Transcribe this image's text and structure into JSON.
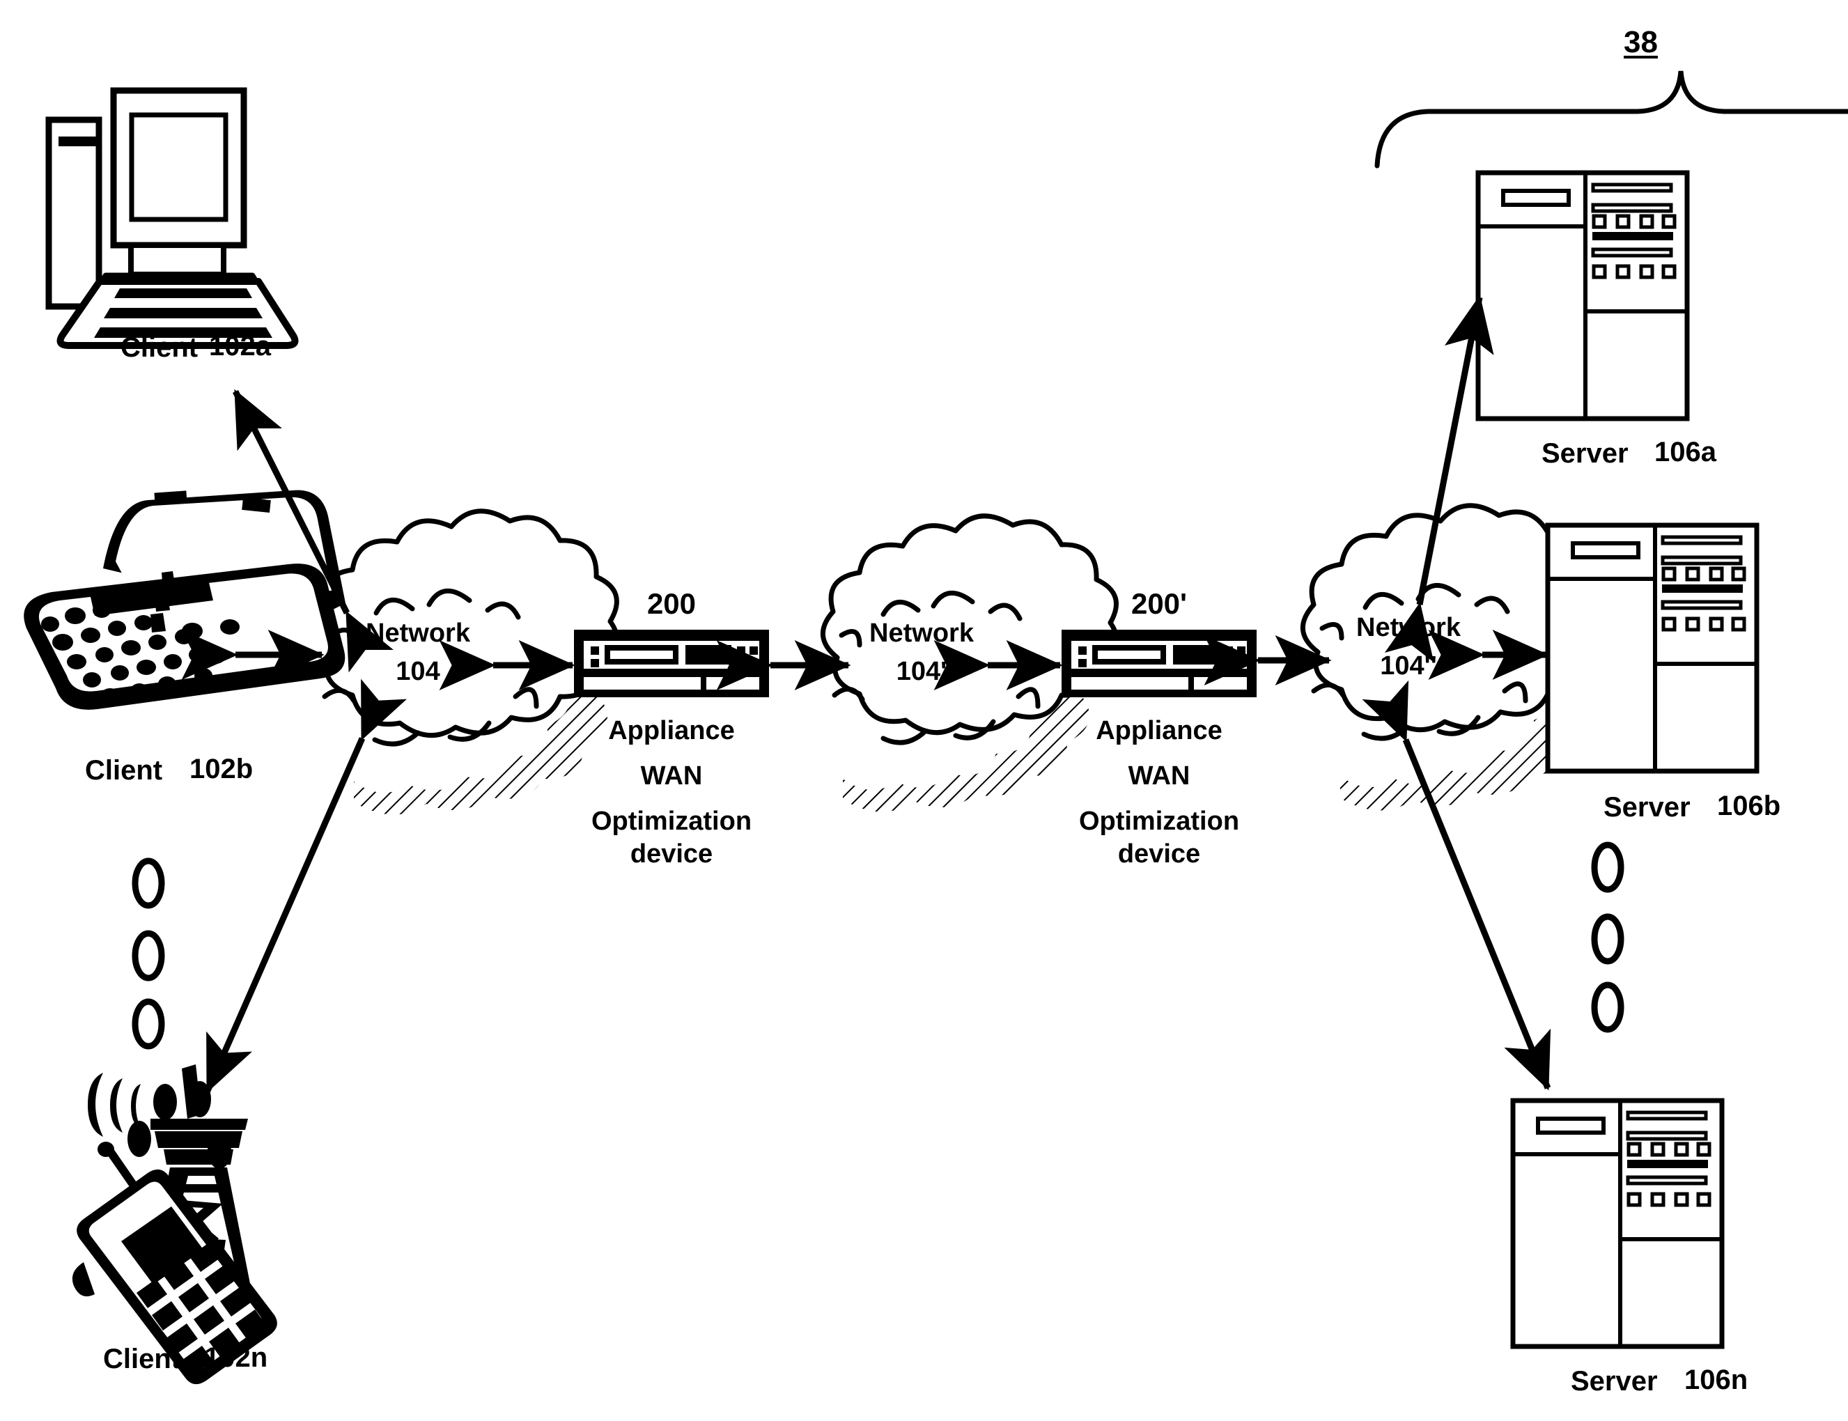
{
  "figure": {
    "reference_numeral": "38",
    "background_color": "#ffffff",
    "line_color": "#000000"
  },
  "clients": [
    {
      "id": "102a",
      "name": "Client",
      "number": "102a",
      "icon": "desktop-computer-icon"
    },
    {
      "id": "102b",
      "name": "Client",
      "number": "102b",
      "icon": "laptop-computer-icon"
    },
    {
      "id": "102n",
      "name": "Client",
      "number": "102n",
      "icon": "mobile-phone-tower-icon"
    }
  ],
  "client_ellipsis": "⚬ ⚬ ⚬",
  "networks": [
    {
      "id": "104",
      "name": "Network",
      "number": "104",
      "icon": "cloud-icon"
    },
    {
      "id": "104p",
      "name": "Network",
      "number": "104'",
      "icon": "cloud-icon"
    },
    {
      "id": "104pp",
      "name": "Network",
      "number": "104''",
      "icon": "cloud-icon"
    }
  ],
  "appliances": [
    {
      "id": "200",
      "number": "200",
      "icon": "network-appliance-icon",
      "caption_lines": [
        "Appliance",
        "WAN",
        "Optimization",
        "device"
      ]
    },
    {
      "id": "200p",
      "number": "200'",
      "icon": "network-appliance-icon",
      "caption_lines": [
        "Appliance",
        "WAN",
        "Optimization",
        "device"
      ]
    }
  ],
  "servers": [
    {
      "id": "106a",
      "name": "Server",
      "number": "106a",
      "icon": "server-tower-icon"
    },
    {
      "id": "106b",
      "name": "Server",
      "number": "106b",
      "icon": "server-tower-icon"
    },
    {
      "id": "106n",
      "name": "Server",
      "number": "106n",
      "icon": "server-tower-icon"
    }
  ],
  "server_ellipsis": "⚬ ⚬ ⚬",
  "connections": [
    {
      "from": "102a",
      "to": "104",
      "arrow": "double"
    },
    {
      "from": "102b",
      "to": "104",
      "arrow": "double"
    },
    {
      "from": "102n",
      "to": "104",
      "arrow": "double"
    },
    {
      "from": "104",
      "to": "200",
      "arrow": "double"
    },
    {
      "from": "200",
      "to": "104p",
      "arrow": "double"
    },
    {
      "from": "104p",
      "to": "200p",
      "arrow": "double"
    },
    {
      "from": "200p",
      "to": "104pp",
      "arrow": "double"
    },
    {
      "from": "104pp",
      "to": "106a",
      "arrow": "double"
    },
    {
      "from": "104pp",
      "to": "106b",
      "arrow": "double"
    },
    {
      "from": "104pp",
      "to": "106n",
      "arrow": "double"
    }
  ]
}
